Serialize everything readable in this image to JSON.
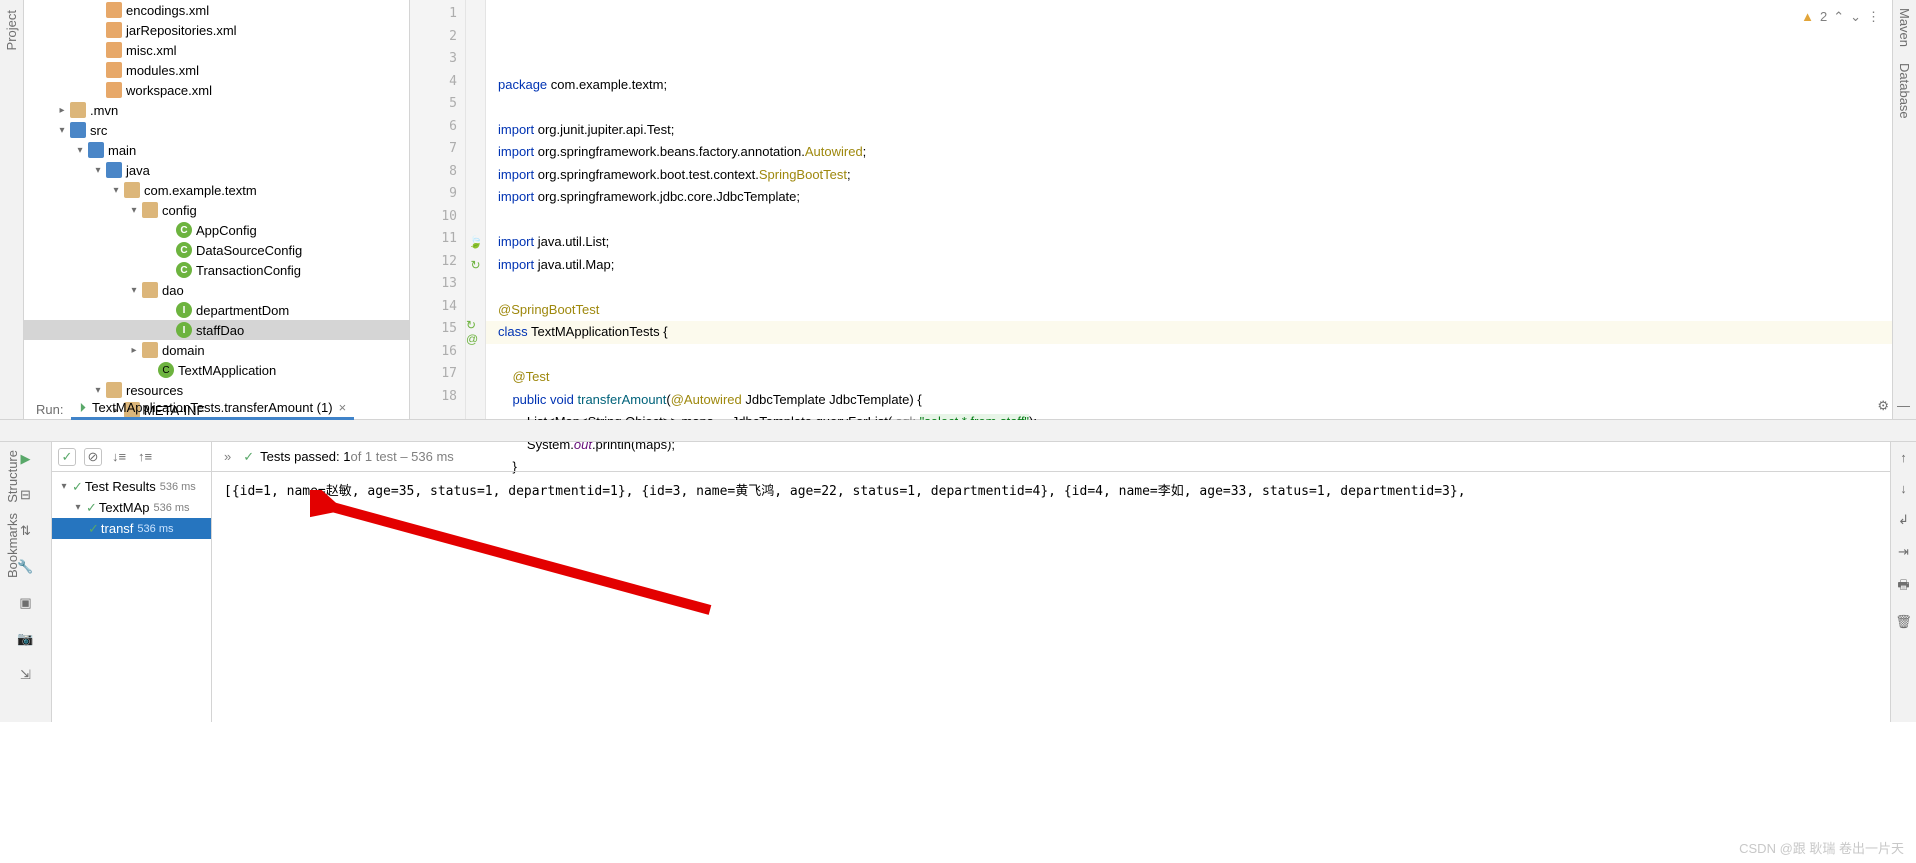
{
  "leftRail": {
    "project": "Project"
  },
  "rightRail": {
    "maven": "Maven",
    "database": "Database"
  },
  "botRail": {
    "structure": "Structure",
    "bookmarks": "Bookmarks"
  },
  "tree": [
    {
      "pad": 66,
      "ico": "xml",
      "label": "encodings.xml"
    },
    {
      "pad": 66,
      "ico": "xml",
      "label": "jarRepositories.xml"
    },
    {
      "pad": 66,
      "ico": "xml",
      "label": "misc.xml"
    },
    {
      "pad": 66,
      "ico": "xml",
      "label": "modules.xml"
    },
    {
      "pad": 66,
      "ico": "xml",
      "label": "workspace.xml"
    },
    {
      "pad": 30,
      "chev": "r",
      "ico": "fld",
      "label": ".mvn"
    },
    {
      "pad": 30,
      "chev": "d",
      "ico": "fld-b",
      "label": "src"
    },
    {
      "pad": 48,
      "chev": "d",
      "ico": "fld-b",
      "label": "main"
    },
    {
      "pad": 66,
      "chev": "d",
      "ico": "fld-b",
      "label": "java"
    },
    {
      "pad": 84,
      "chev": "d",
      "ico": "fld",
      "label": "com.example.textm"
    },
    {
      "pad": 102,
      "chev": "d",
      "ico": "fld",
      "label": "config"
    },
    {
      "pad": 136,
      "ico": "cls",
      "label": "AppConfig",
      "g": "C"
    },
    {
      "pad": 136,
      "ico": "cls",
      "label": "DataSourceConfig",
      "g": "C"
    },
    {
      "pad": 136,
      "ico": "cls",
      "label": "TransactionConfig",
      "g": "C"
    },
    {
      "pad": 102,
      "chev": "d",
      "ico": "fld",
      "label": "dao"
    },
    {
      "pad": 136,
      "ico": "int",
      "label": "departmentDom",
      "g": "I"
    },
    {
      "pad": 136,
      "ico": "int",
      "label": "staffDao",
      "g": "I",
      "sel": true
    },
    {
      "pad": 102,
      "chev": "r",
      "ico": "fld",
      "label": "domain"
    },
    {
      "pad": 118,
      "ico": "leaf",
      "label": "TextMApplication",
      "g": "C"
    },
    {
      "pad": 66,
      "chev": "d",
      "ico": "fld",
      "label": "resources"
    },
    {
      "pad": 84,
      "chev": "r",
      "ico": "fld",
      "label": "META-INF"
    }
  ],
  "editor": {
    "warnCount": "2",
    "lines": [
      {
        "n": 1,
        "html": "<span class='kw'>package</span> com.example.textm;"
      },
      {
        "n": 2,
        "html": ""
      },
      {
        "n": 3,
        "html": "<span class='kw'>import</span> org.junit.jupiter.api.Test;"
      },
      {
        "n": 4,
        "html": "<span class='kw'>import</span> org.springframework.beans.factory.annotation.<span class='anno'>Autowired</span>;"
      },
      {
        "n": 5,
        "html": "<span class='kw'>import</span> org.springframework.boot.test.context.<span class='anno'>SpringBootTest</span>;"
      },
      {
        "n": 6,
        "html": "<span class='kw'>import</span> org.springframework.jdbc.core.JdbcTemplate;"
      },
      {
        "n": 7,
        "html": ""
      },
      {
        "n": 8,
        "html": "<span class='kw'>import</span> java.util.List;"
      },
      {
        "n": 9,
        "html": "<span class='kw'>import</span> java.util.Map;"
      },
      {
        "n": 10,
        "html": ""
      },
      {
        "n": 11,
        "html": "<span class='anno'>@SpringBootTest</span>",
        "gi": "🍃"
      },
      {
        "n": 12,
        "html": "<span class='kw'>class</span> TextMApplicationTests {",
        "gi": "↻"
      },
      {
        "n": 13,
        "html": ""
      },
      {
        "n": 14,
        "html": "    <span class='anno'>@Test</span>"
      },
      {
        "n": 15,
        "html": "    <span class='kw'>public void</span> <span class='fn-def'>transferAmount</span>(<span class='anno'>@Autowired</span> JdbcTemplate JdbcTemplate) {",
        "gi": "↻ @",
        "hl": true
      },
      {
        "n": 16,
        "html": "        List&lt;Map&lt;String,Object&gt;&gt; maps =  JdbcTemplate.queryForList( <span class='sql-lbl'>sql:</span> <span class='str'>\"select * from staff\"</span>);"
      },
      {
        "n": 17,
        "html": "        System.<span class='it'>out</span>.println(maps);"
      },
      {
        "n": 18,
        "html": "    }"
      }
    ]
  },
  "run": {
    "headerLabel": "Run:",
    "tabTitle": "TextMApplicationTests.transferAmount (1)",
    "summary": {
      "prefix": "Tests passed: 1",
      "suffix": " of 1 test – 536 ms"
    },
    "tests": [
      {
        "pad": 0,
        "chev": "d",
        "label": "Test Results",
        "ms": "536 ms"
      },
      {
        "pad": 14,
        "chev": "d",
        "label": "TextMAp",
        "ms": "536 ms"
      },
      {
        "pad": 32,
        "label": "transf",
        "ms": "536 ms",
        "sel": true
      }
    ],
    "output": "[{id=1, name=赵敏, age=35, status=1, departmentid=1}, {id=3, name=黄飞鸿, age=22, status=1, departmentid=4}, {id=4, name=李如, age=33, status=1, departmentid=3},"
  },
  "watermark": "CSDN @跟 耿瑞 卷出一片天"
}
